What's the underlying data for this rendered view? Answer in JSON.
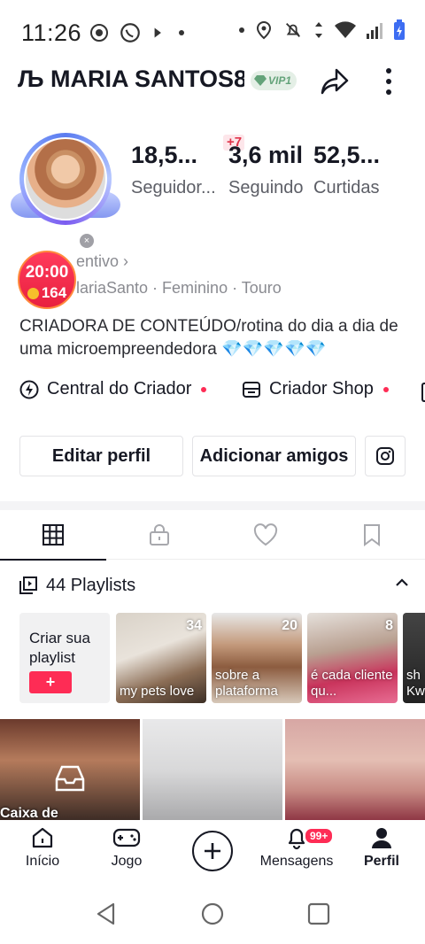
{
  "status_bar": {
    "time": "11:26"
  },
  "header": {
    "username": "Љ MARIA SANTOS8",
    "vip_label": "VIP1"
  },
  "profile": {
    "stats": [
      {
        "value": "18,5...",
        "label": "Seguidor..."
      },
      {
        "value": "3,6 mil",
        "label": "Seguindo"
      },
      {
        "value": "52,5...",
        "label": "Curtidas"
      }
    ],
    "new_following": "+7",
    "live_badge": {
      "time": "20:00",
      "coins": "164"
    },
    "incentive_text": "entivo ›",
    "meta_line": "lariaSanto · Feminino · Touro",
    "bio": "CRIADORA DE CONTEÚDO/rotina do dia a dia de uma microempreendedora 💎💎💎💎💎",
    "quick_links": [
      "Central do Criador",
      "Criador Shop"
    ],
    "buttons": {
      "edit": "Editar perfil",
      "add_friends": "Adicionar amigos"
    }
  },
  "playlists": {
    "title": "44 Playlists",
    "create_label": "Criar sua playlist",
    "create_button": "+",
    "items": [
      {
        "count": "34",
        "name": "my pets love"
      },
      {
        "count": "20",
        "name": "sobre a plataforma"
      },
      {
        "count": "8",
        "name": "é cada cliente qu..."
      },
      {
        "count": "",
        "name": "sh Kw"
      }
    ]
  },
  "videos": [
    {
      "caption": "Caixa de"
    },
    {
      "caption": ""
    },
    {
      "caption": ""
    }
  ],
  "bottom_nav": {
    "items": [
      "Início",
      "Jogo",
      "Mensagens",
      "Perfil"
    ],
    "messages_badge": "99+"
  },
  "colors": {
    "accent": "#fe2c55",
    "text": "#161823",
    "muted": "#8a8b91",
    "vip": "#64a37a"
  }
}
